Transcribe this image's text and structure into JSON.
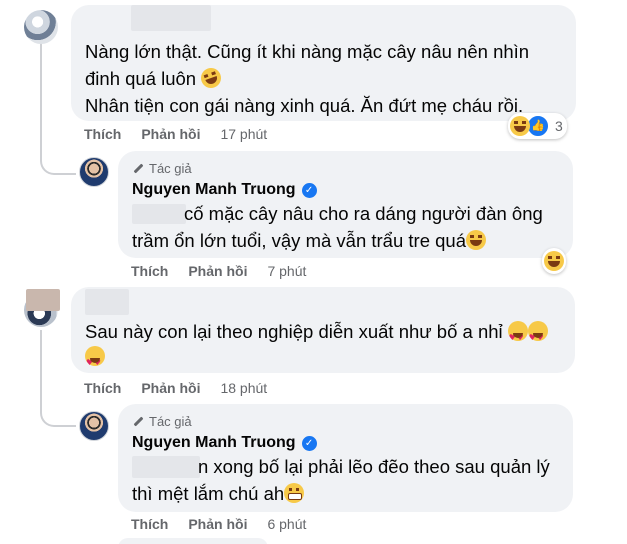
{
  "comments": [
    {
      "lines": [
        "Nàng lớn thật. Cũng ít khi nàng mặc cây nâu nên nhìn",
        "đinh quá luôn",
        "Nhân tiện con gái nàng xinh quá. Ăn đứt mẹ cháu rồi."
      ],
      "actions": {
        "like": "Thích",
        "reply": "Phản hồi",
        "time": "17 phút"
      },
      "reactions": {
        "icons": [
          "laugh-emoji",
          "like-icon"
        ],
        "count": "3"
      }
    },
    {
      "author_badge": "Tác giả",
      "name": "Nguyen Manh Truong",
      "lines": [
        "cố mặc cây nâu cho ra dáng người đàn ông",
        "trầm ổn lớn tuổi, vậy mà vẫn trẩu tre quá"
      ],
      "actions": {
        "like": "Thích",
        "reply": "Phản hồi",
        "time": "7 phút"
      },
      "reactions": {
        "icons": [
          "laugh-emoji"
        ]
      }
    },
    {
      "lines": [
        "Sau này con lại theo nghiệp diễn xuất như bố a nhỉ"
      ],
      "actions": {
        "like": "Thích",
        "reply": "Phản hồi",
        "time": "18 phút"
      }
    },
    {
      "author_badge": "Tác giả",
      "name": "Nguyen Manh Truong",
      "lines": [
        "n xong bố lại phải lẽo đẽo theo sau quản lý",
        "thì mệt lắm chú ah"
      ],
      "actions": {
        "like": "Thích",
        "reply": "Phản hồi",
        "time": "6 phút"
      }
    }
  ],
  "colors": {
    "bubble": "#f0f2f5",
    "meta_text": "#65676b",
    "accent_blue": "#1877f2"
  }
}
